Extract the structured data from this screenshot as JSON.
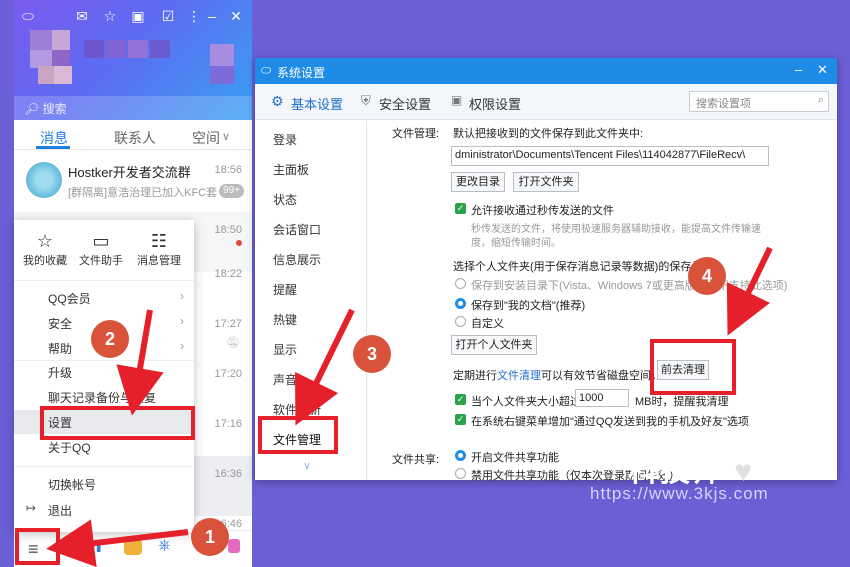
{
  "qq": {
    "search_placeholder": "搜索",
    "tabs": [
      "消息",
      "联系人",
      "空间"
    ],
    "chats": [
      {
        "name": "Hostker开发者交流群",
        "preview": "[群隔离]意浩治理已加入KFC套",
        "time": "18:56",
        "badge": "99+"
      },
      {
        "name": "",
        "preview": "",
        "time": "18:50",
        "badge": ""
      },
      {
        "name": "",
        "preview": "",
        "time": "18:22",
        "badge": ""
      },
      {
        "name": "",
        "preview": "",
        "time": "17:27",
        "badge": ""
      },
      {
        "name": "",
        "preview": "",
        "time": "17:20",
        "badge": ""
      },
      {
        "name": "",
        "preview": "",
        "time": "17:16",
        "badge": ""
      },
      {
        "name": "",
        "preview": "",
        "time": "16:36",
        "badge": ""
      },
      {
        "name": "",
        "preview": "",
        "time": "16:46",
        "badge": ""
      }
    ]
  },
  "menu": {
    "quick": [
      "我的收藏",
      "文件助手",
      "消息管理"
    ],
    "items": [
      "QQ会员",
      "安全",
      "帮助",
      "升级",
      "聊天记录备份与恢复",
      "设置",
      "关于QQ",
      "切换帐号",
      "退出"
    ]
  },
  "window": {
    "title": "系统设置",
    "tabs": [
      "基本设置",
      "安全设置",
      "权限设置"
    ],
    "search_placeholder": "搜索设置项",
    "left_items": [
      "登录",
      "主面板",
      "状态",
      "会话窗口",
      "信息展示",
      "提醒",
      "热键",
      "显示",
      "声音",
      "软件更新",
      "文件管理"
    ],
    "file_mgmt_label": "文件管理:",
    "file_default_text": "默认把接收到的文件保存到此文件夹中:",
    "file_path": "dministrator\\Documents\\Tencent Files\\114042877\\FileRecv\\",
    "btn_change_dir": "更改目录",
    "btn_open_folder": "打开文件夹",
    "cb_secure_transfer": "允许接收通过秒传发送的文件",
    "secure_desc1": "秒传发送的文件，将使用极速服务器辅助接收，能提高文件传输速",
    "secure_desc2": "度，缩短传输时间。",
    "personal_folder_text": "选择个人文件夹(用于保存消息记录等数据)的保存位置",
    "rb_install": "保存到安装目录下(Vista、Windows 7或更高版本下不支持此选项)",
    "rb_mydocs": "保存到\"我的文档\"(推荐)",
    "rb_custom": "自定义",
    "btn_open_personal": "打开个人文件夹",
    "cleanup_pre": "定期进行",
    "cleanup_link": "文件清理",
    "cleanup_post": "可以有效节省磁盘空间。",
    "btn_cleanup": "前去清理",
    "cb_size_pre": "当个人文件夹大小超过",
    "cb_size_value": "1000",
    "cb_size_post": "MB时，提醒我清理",
    "cb_context_menu": "在系统右键菜单增加\"通过QQ发送到我的手机及好友\"选项",
    "share_label": "文件共享:",
    "share_on": "开启文件共享功能",
    "share_off": "禁用文件共享功能（仅本次登录期间生效）"
  },
  "steps": [
    "1",
    "2",
    "3",
    "4"
  ],
  "watermark": {
    "brand": "科技师",
    "url": "https://www.3kjs.com"
  },
  "colors": {
    "accent": "#1e8be6",
    "annotation": "#e5202a",
    "step_circle": "#d9533b",
    "background": "#6b5fd6"
  }
}
